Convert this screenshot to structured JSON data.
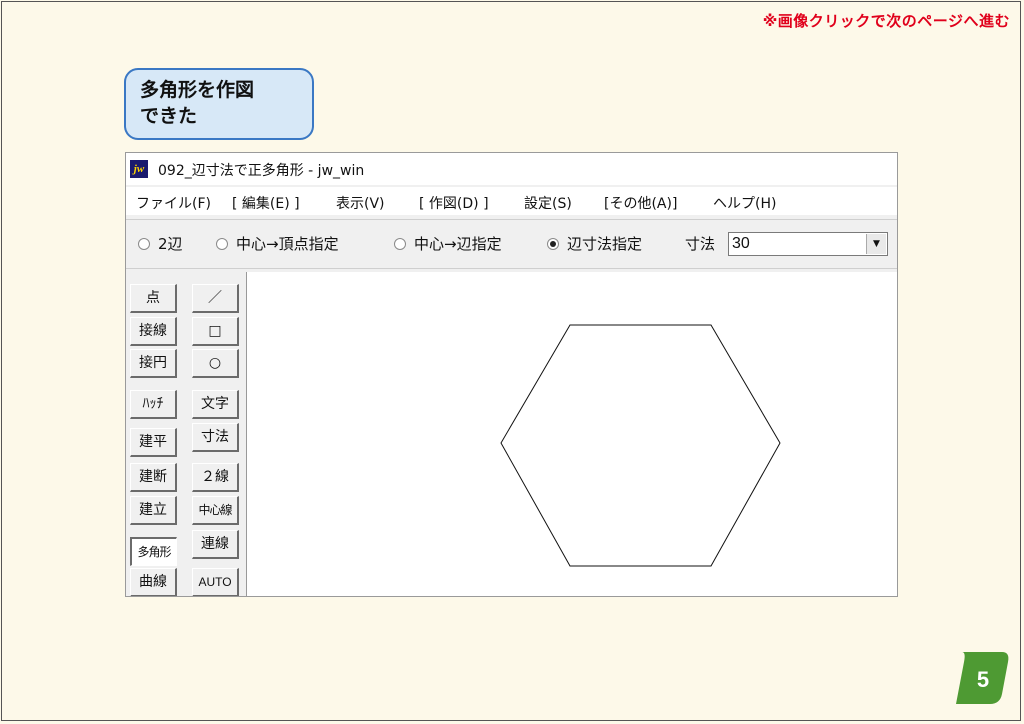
{
  "notice": "※画像クリックで次のページへ進む",
  "callout": {
    "line1": "多角形を作図",
    "line2": "できた"
  },
  "window": {
    "icon_text": "jw",
    "title": "092_辺寸法で正多角形 - jw_win",
    "menu": [
      "ファイル(F)",
      "[ 編集(E) ]",
      "表示(V)",
      "[ 作図(D) ]",
      "設定(S)",
      "[その他(A)]",
      "ヘルプ(H)"
    ]
  },
  "options": {
    "modes": [
      {
        "label": "2辺",
        "selected": false
      },
      {
        "label": "中心→頂点指定",
        "selected": false
      },
      {
        "label": "中心→辺指定",
        "selected": false
      },
      {
        "label": "辺寸法指定",
        "selected": true
      }
    ],
    "dim_label": "寸法",
    "dim_value": "30"
  },
  "tools_left": [
    "点",
    "接線",
    "接円",
    "ﾊｯﾁ",
    "建平",
    "建断",
    "建立",
    "多角形",
    "曲線"
  ],
  "tools_right": [
    "／",
    "□",
    "○",
    "文字",
    "寸法",
    "２線",
    "中心線",
    "連線",
    "AUTO"
  ],
  "active_tool": "多角形",
  "drawing": {
    "shape": "regular-hexagon",
    "sides": 6
  },
  "page_number": "5",
  "colors": {
    "notice": "#e0001b",
    "callout_border": "#3a78c4",
    "callout_bg": "#d7e8f7",
    "badge": "#4e9a33"
  }
}
